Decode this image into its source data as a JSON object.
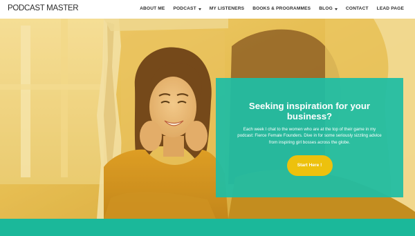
{
  "header": {
    "logo": "PODCAST MASTER",
    "nav": [
      {
        "label": "ABOUT ME",
        "dropdown": false
      },
      {
        "label": "PODCAST",
        "dropdown": true
      },
      {
        "label": "MY LISTENERS",
        "dropdown": false
      },
      {
        "label": "BOOKS & PROGRAMMES",
        "dropdown": false
      },
      {
        "label": "BLOG",
        "dropdown": true
      },
      {
        "label": "CONTACT",
        "dropdown": false
      },
      {
        "label": "LEAD PAGE",
        "dropdown": false
      }
    ]
  },
  "hero": {
    "title": "Seeking inspiration for your business?",
    "body": "Each week I chat to the women who are at the top of their game in my podcast: Fierce Female Founders. Dive in for some seriously sizzling advice from inspiring girl bosses across the globe.",
    "button_label": "Start Here !"
  },
  "colors": {
    "accent_teal": "#20BDA4",
    "button_yellow": "#EDC10D",
    "band_teal": "#1BB89A",
    "hero_tint": "#E2B84A"
  }
}
